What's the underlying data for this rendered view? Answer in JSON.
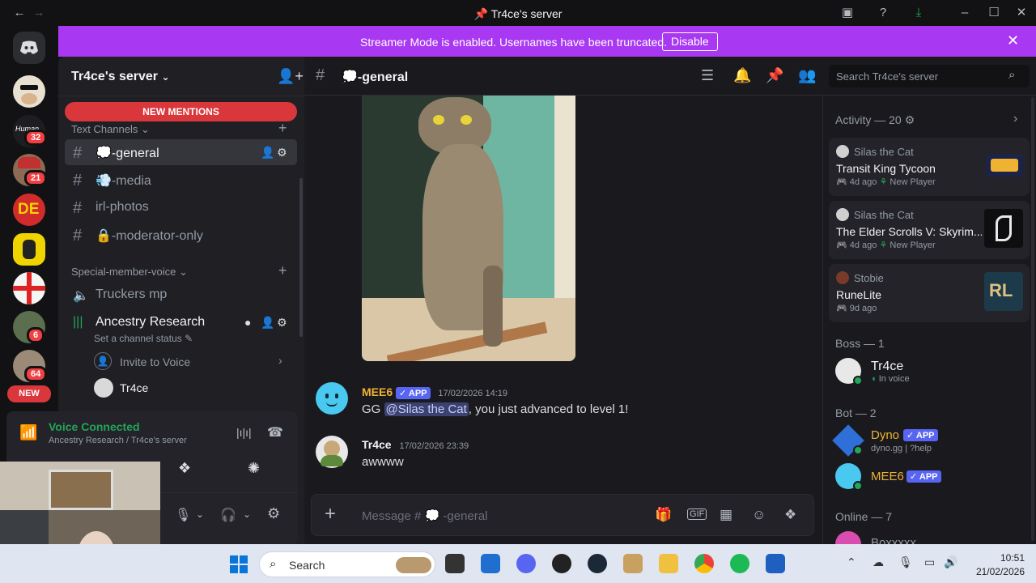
{
  "window": {
    "title": "Tr4ce's server"
  },
  "banner": {
    "text": "Streamer Mode is enabled. Usernames have been truncated.",
    "button": "Disable"
  },
  "rail": {
    "badges": [
      "32",
      "21",
      "6",
      "64"
    ],
    "new_label": "NEW"
  },
  "sidebar": {
    "server_name": "Tr4ce's server",
    "new_mentions": "NEW MENTIONS",
    "category_text": "Text Channels",
    "channels": [
      {
        "name": "-general",
        "emoji": "💭"
      },
      {
        "name": "-media",
        "emoji": "💨"
      },
      {
        "name": "irl-photos",
        "emoji": ""
      },
      {
        "name": "-moderator-only",
        "emoji": "🔒"
      }
    ],
    "category_voice": "Special-member-voice",
    "voice_channels": [
      {
        "name": "Truckers mp"
      },
      {
        "name": "Ancestry Research",
        "status": "Set a channel status"
      }
    ],
    "invite_label": "Invite to Voice",
    "voice_user": "Tr4ce",
    "voice_connected": "Voice Connected",
    "voice_location": "Ancestry Research / Tr4ce's server"
  },
  "chat": {
    "channel_name": "-general",
    "channel_emoji": "💭",
    "search_placeholder": "Search Tr4ce's server",
    "messages": [
      {
        "author": "MEE6",
        "badge": "APP",
        "time": "17/02/2026 14:19",
        "pre": "GG ",
        "mention": "@Silas the Cat",
        "post": ", you just advanced to level 1!"
      },
      {
        "author": "Tr4ce",
        "time": "17/02/2026 23:39",
        "text": "awwww"
      }
    ],
    "composer_placeholder": "Message # 💭 -general"
  },
  "members": {
    "activity_header": "Activity — 20",
    "activities": [
      {
        "user": "Silas the Cat",
        "game": "Transit King Tycoon",
        "ago": "4d ago",
        "tag": "New Player"
      },
      {
        "user": "Silas the Cat",
        "game": "The Elder Scrolls V: Skyrim...",
        "ago": "4d ago",
        "tag": "New Player"
      },
      {
        "user": "Stobie",
        "game": "RuneLite",
        "ago": "9d ago",
        "tag": ""
      }
    ],
    "boss_header": "Boss — 1",
    "boss": {
      "name": "Tr4ce",
      "status": "In voice"
    },
    "bot_header": "Bot — 2",
    "bots": [
      {
        "name": "Dyno",
        "badge": "APP",
        "sub": "dyno.gg | ?help",
        "color": "#f0b232"
      },
      {
        "name": "MEE6",
        "badge": "APP",
        "sub": "",
        "color": "#f0b232"
      }
    ],
    "online_header": "Online — 7",
    "online_partial": "Boxxxxx"
  },
  "taskbar": {
    "search": "Search",
    "time": "10:51",
    "date": "21/02/2026"
  },
  "colors": {
    "banner": "#a938f2",
    "accent": "#5865f2",
    "mention_bg": "#3c4270",
    "danger": "#da373c",
    "green": "#23a55a"
  }
}
